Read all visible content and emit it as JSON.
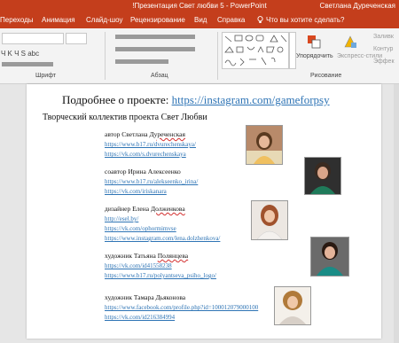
{
  "window": {
    "title": "!Презентация Свет любви 5 - PowerPoint",
    "user": "Светлана Дуреченская"
  },
  "tabs": {
    "items": [
      "Переходы",
      "Анимация",
      "Слайд-шоу",
      "Рецензирование",
      "Вид",
      "Справка"
    ],
    "tell_me": "Что вы хотите сделать?"
  },
  "ribbon": {
    "font_group": "Шрифт",
    "paragraph_group": "Абзац",
    "drawing_group": "Рисование",
    "arrange": "Упорядочить",
    "quick_styles": "Экспресс-стили",
    "fill": "Заливк",
    "outline": "Контур",
    "effects": "Эффек"
  },
  "slide": {
    "headline_prefix": "Подробнее о проекте: ",
    "headline_link": "https://instagram.com/gameforpsy",
    "subtitle": "Творческий коллектив проекта Свет Любви",
    "authors": [
      {
        "role": "автор Светлана ",
        "surname": "Дуреченская",
        "links": [
          "https://www.b17.ru/dvurechenskaya/",
          "https://vk.com/s.dvurechenskaya"
        ]
      },
      {
        "role": "соавтор  Ирина Алексеенко",
        "surname": "",
        "links": [
          "https://www.b17.ru/alekseenko_irina/",
          "https://vk.com/iriskanara"
        ]
      },
      {
        "role": "дизайнер Елена  ",
        "surname": "Долженкова",
        "links": [
          "http://esel.by/",
          "https://vk.com/ophormimvse",
          "https://www.instagram.com/lena.dolzhenkova/"
        ]
      },
      {
        "role": "художник Татьяна ",
        "surname": "Полянцева",
        "links": [
          "https://vk.com/id41558238",
          "https://www.b17.ru/polyantseva_psiho_logo/"
        ]
      },
      {
        "role": "художник Тамара Дьяконова",
        "surname": "",
        "links": [
          "https://www.facebook.com/profile.php?id=100012079000100",
          "https://vk.com/id216384994"
        ]
      }
    ]
  },
  "colors": {
    "ribbon_accent": "#c43e1c",
    "link": "#2e74b5"
  }
}
